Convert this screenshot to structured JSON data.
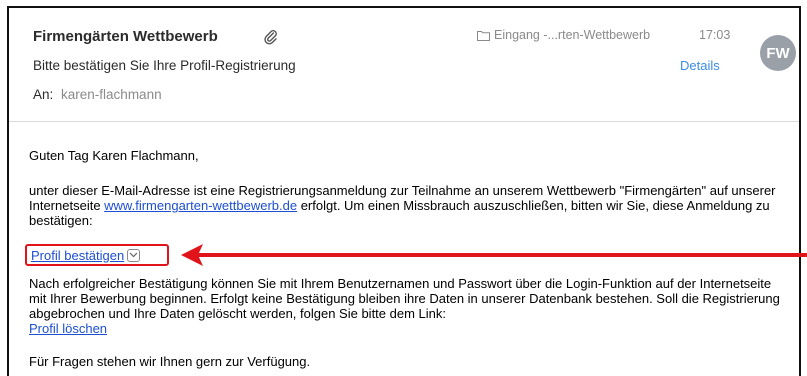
{
  "email": {
    "sender": "Firmengärten Wettbewerb",
    "subject": "Bitte bestätigen Sie Ihre Profil-Registrierung",
    "to_label": "An:",
    "to_value": "karen-flachmann",
    "folder": "Eingang -...rten-Wettbewerb",
    "time": "17:03",
    "details_label": "Details",
    "avatar_initials": "FW"
  },
  "body": {
    "greeting": "Guten Tag Karen Flachmann,",
    "para1_a": "unter dieser E-Mail-Adresse ist eine Registrierungsanmeldung zur Teilnahme an unserem Wettbewerb \"Firmengärten\" auf unserer Internetseite ",
    "para1_link": "www.firmengarten-wettbewerb.de",
    "para1_b": " erfolgt. Um einen Missbrauch auszuschließen, bitten wir Sie, diese Anmeldung zu bestätigen:",
    "confirm_link": "Profil bestätigen",
    "para2": "Nach erfolgreicher Bestätigung können Sie mit Ihrem Benutzernamen und Passwort über die Login-Funktion auf der Internetseite mit Ihrer Bewerbung beginnen. Erfolgt keine Bestätigung bleiben ihre Daten in unserer Datenbank bestehen. Soll die Registrierung abgebrochen und Ihre Daten gelöscht werden, folgen Sie bitte dem Link:",
    "delete_link": "Profil löschen",
    "para3": "Für Fragen stehen wir Ihnen gern zur Verfügung."
  },
  "colors": {
    "highlight": "#e0141a",
    "link": "#1d4fd6",
    "details": "#3b8ee8"
  }
}
